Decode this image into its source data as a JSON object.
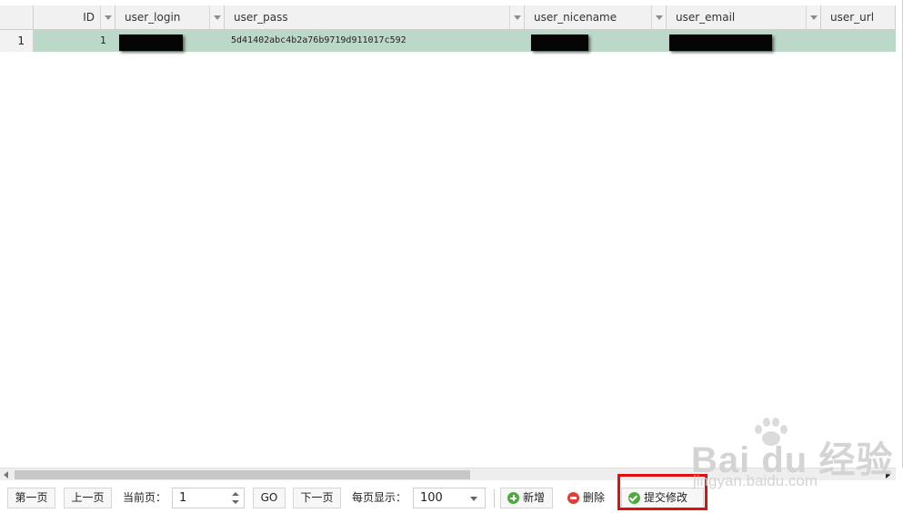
{
  "columns": [
    {
      "name": "ID"
    },
    {
      "name": "user_login"
    },
    {
      "name": "user_pass"
    },
    {
      "name": "user_nicename"
    },
    {
      "name": "user_email"
    },
    {
      "name": "user_url"
    }
  ],
  "rows": [
    {
      "row_number": "1",
      "id": "1",
      "user_login": "",
      "user_pass": "5d41402abc4b2a76b9719d911017c592",
      "user_nicename": "",
      "user_email": "",
      "user_url": ""
    }
  ],
  "toolbar": {
    "first_page": "第一页",
    "prev_page": "上一页",
    "current_page_label": "当前页：",
    "current_page_value": "1",
    "go": "GO",
    "next_page": "下一页",
    "per_page_label": "每页显示：",
    "per_page_value": "100",
    "add": "新增",
    "delete": "删除",
    "submit": "提交修改"
  },
  "watermark": {
    "brand": "Bai du 经验",
    "url": "jingyan.baidu.com"
  },
  "colors": {
    "selected_row": "#bcd8c8",
    "highlight_box": "#e01010",
    "add_icon": "#4eaa40",
    "delete_icon": "#d9413a"
  },
  "icons": {
    "add": "plus-circle-icon",
    "delete": "minus-circle-icon",
    "submit": "check-circle-icon"
  }
}
